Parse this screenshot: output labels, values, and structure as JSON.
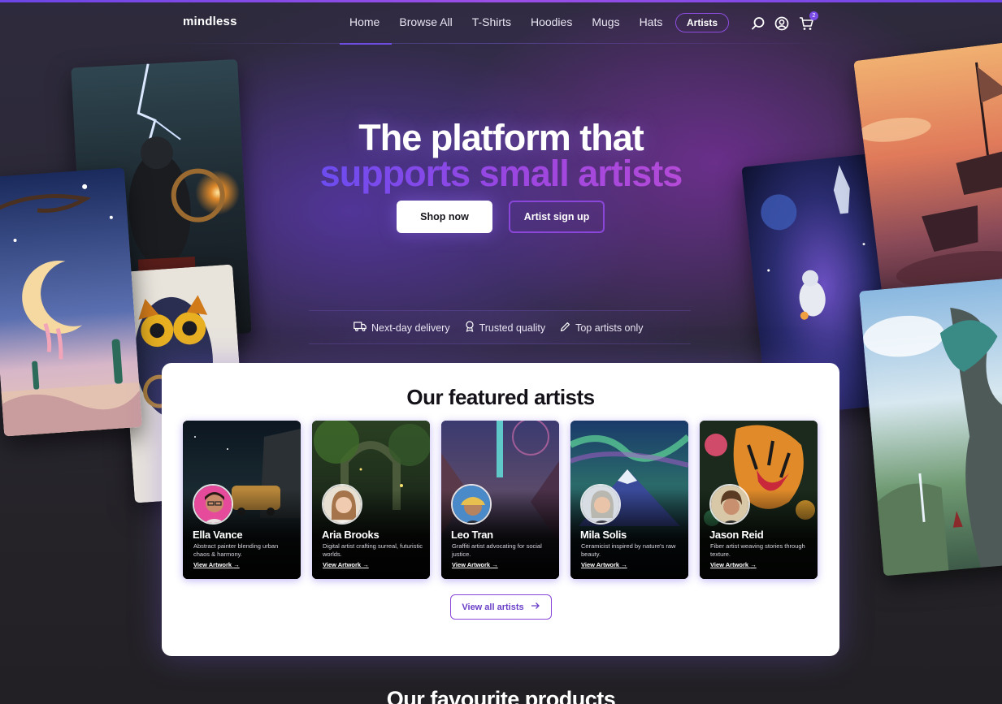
{
  "nav": {
    "logo": "mindless",
    "links": [
      "Home",
      "Browse All",
      "T-Shirts",
      "Hoodies",
      "Mugs",
      "Hats"
    ],
    "artists_label": "Artists",
    "cart_count": "2",
    "icons": [
      "search-icon",
      "account-icon",
      "cart-icon"
    ]
  },
  "hero": {
    "title_line1": "The platform that",
    "title_line2": "supports small artists",
    "shop_button": "Shop now",
    "artist_button": "Artist sign up",
    "features": [
      {
        "icon": "truck-icon",
        "label": "Next-day delivery"
      },
      {
        "icon": "badge-icon",
        "label": "Trusted quality"
      },
      {
        "icon": "pencil-icon",
        "label": "Top artists only"
      }
    ]
  },
  "featured": {
    "title": "Our featured artists",
    "artists": [
      {
        "name": "Ella Vance",
        "description": "Abstract painter blending urban chaos & harmony.",
        "link": "View Artwork"
      },
      {
        "name": "Aria Brooks",
        "description": "Digital artist crafting surreal, futuristic worlds.",
        "link": "View Artwork"
      },
      {
        "name": "Leo Tran",
        "description": "Graffiti artist advocating for social justice.",
        "link": "View Artwork"
      },
      {
        "name": "Mila Solis",
        "description": "Ceramicist inspired by nature's raw beauty.",
        "link": "View Artwork"
      },
      {
        "name": "Jason Reid",
        "description": "Fiber artist weaving stories through texture.",
        "link": "View Artwork"
      }
    ],
    "view_all": "View all artists"
  },
  "products": {
    "title": "Our favourite products"
  },
  "colors": {
    "accent": "#8a46d8",
    "accent_blue": "#6c4cf0",
    "background": "#26242b"
  }
}
